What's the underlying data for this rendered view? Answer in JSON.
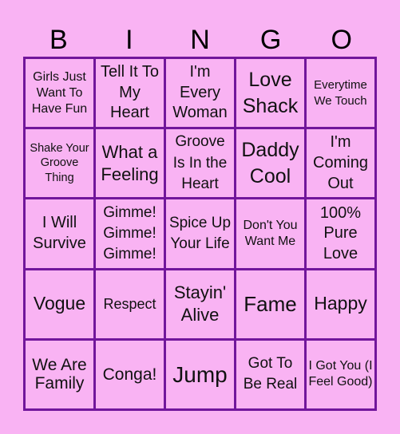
{
  "title_letters": [
    "B",
    "I",
    "N",
    "G",
    "O"
  ],
  "colors": {
    "background": "#f9b3f3",
    "grid_border": "#71169b",
    "text": "#111111"
  },
  "cells": [
    [
      "Girls Just Want To Have Fun",
      "Tell It To My Heart",
      "I'm Every Woman",
      "Love Shack",
      "Everytime We Touch"
    ],
    [
      "Shake Your Groove Thing",
      "What a Feeling",
      "Groove Is In the Heart",
      "Daddy Cool",
      "I'm Coming Out"
    ],
    [
      "I Will Survive",
      "Gimme! Gimme! Gimme!",
      "Spice Up Your Life",
      "Don't You Want Me",
      "100% Pure Love"
    ],
    [
      "Vogue",
      "Respect",
      "Stayin' Alive",
      "Fame",
      "Happy"
    ],
    [
      "We Are Family",
      "Conga!",
      "Jump",
      "Got To Be Real",
      "I Got You (I Feel Good)"
    ]
  ]
}
